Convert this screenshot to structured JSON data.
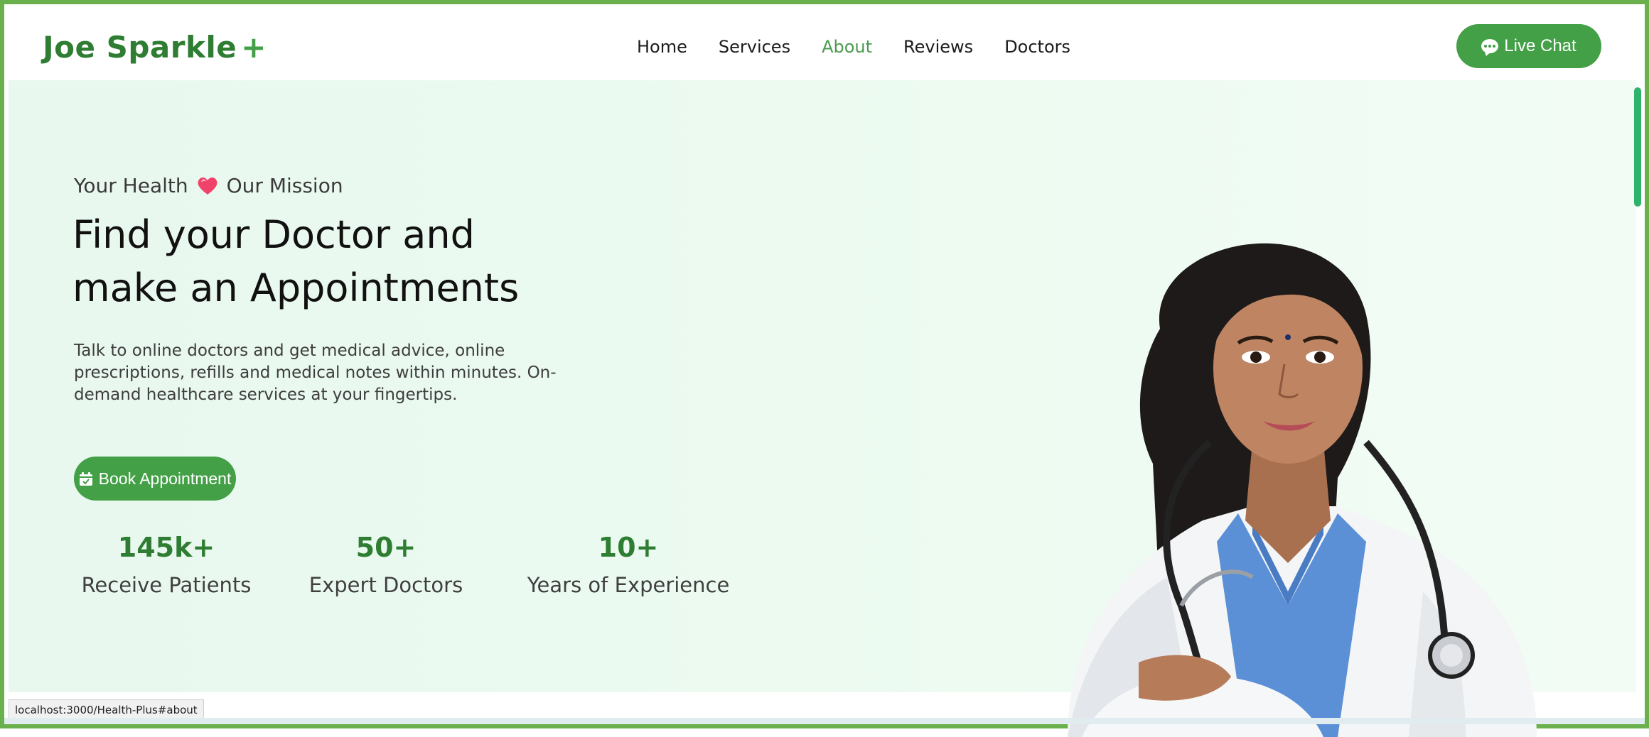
{
  "brand": {
    "name": "Joe Sparkle",
    "plus": "+"
  },
  "nav": {
    "items": [
      {
        "label": "Home",
        "active": false
      },
      {
        "label": "Services",
        "active": false
      },
      {
        "label": "About",
        "active": true
      },
      {
        "label": "Reviews",
        "active": false
      },
      {
        "label": "Doctors",
        "active": false
      }
    ],
    "live_chat_label": "Live Chat"
  },
  "hero": {
    "tagline_left": "Your Health",
    "tagline_right": "Our Mission",
    "headline_line1": "Find your Doctor and",
    "headline_line2": "make an Appointments",
    "description": "Talk to online doctors and get medical advice, online prescriptions, refills and medical notes within minutes. On-demand healthcare services at your fingertips.",
    "cta_label": "Book Appointment"
  },
  "stats": [
    {
      "value": "145k+",
      "label": "Receive Patients"
    },
    {
      "value": "50+",
      "label": "Expert Doctors"
    },
    {
      "value": "10+",
      "label": "Years of Experience"
    }
  ],
  "status_bar": {
    "url": "localhost:3000/Health-Plus#about"
  },
  "colors": {
    "accent": "#43a047",
    "brand": "#2e7d32",
    "hero_bg": "#eaf9ef",
    "frame": "#6ab04c"
  },
  "icons": {
    "chat": "chat-bubble-icon",
    "calendar": "calendar-check-icon",
    "heart": "heart-icon"
  }
}
